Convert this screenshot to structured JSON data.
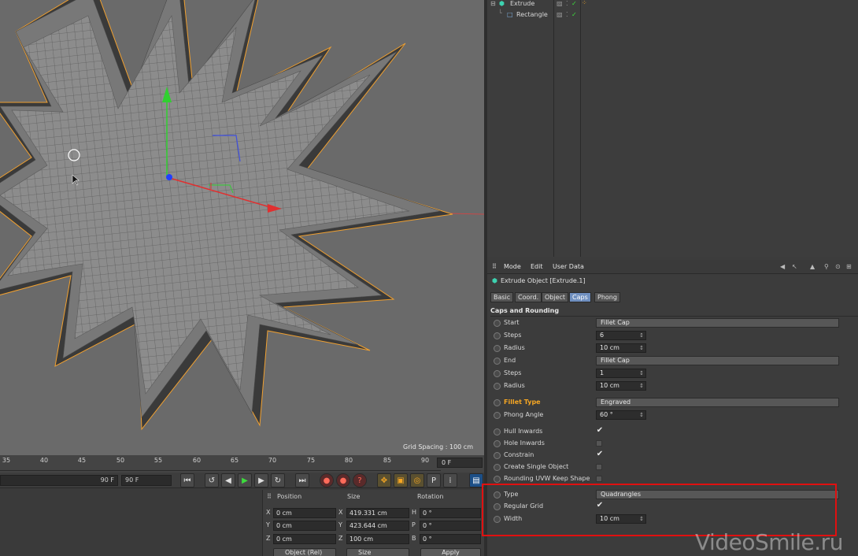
{
  "viewport": {
    "grid_spacing": "Grid Spacing : 100 cm"
  },
  "timeline": {
    "ticks": [
      "35",
      "40",
      "45",
      "50",
      "55",
      "60",
      "65",
      "70",
      "75",
      "80",
      "85",
      "90"
    ],
    "frame_field": "0 F"
  },
  "transport": {
    "end_frame_slider": "90 F",
    "end_frame_field": "90 F"
  },
  "coord_manager": {
    "headers": {
      "position": "Position",
      "size": "Size",
      "rotation": "Rotation"
    },
    "rows": [
      {
        "axis": "X",
        "pos": "0 cm",
        "size_axis": "X",
        "size": "419.331 cm",
        "rot_axis": "H",
        "rot": "0 °"
      },
      {
        "axis": "Y",
        "pos": "0 cm",
        "size_axis": "Y",
        "size": "423.644 cm",
        "rot_axis": "P",
        "rot": "0 °"
      },
      {
        "axis": "Z",
        "pos": "0 cm",
        "size_axis": "Z",
        "size": "100 cm",
        "rot_axis": "B",
        "rot": "0 °"
      }
    ],
    "mode_dropdown": "Object (Rel)",
    "size_dropdown": "Size",
    "apply": "Apply"
  },
  "object_manager": {
    "items": [
      {
        "name": "Extrude"
      },
      {
        "name": "Rectangle"
      }
    ]
  },
  "attributes": {
    "menu": [
      "Mode",
      "Edit",
      "User Data"
    ],
    "title": "Extrude Object [Extrude.1]",
    "tabs": [
      "Basic",
      "Coord.",
      "Object",
      "Caps",
      "Phong"
    ],
    "active_tab": "Caps",
    "section": "Caps and Rounding",
    "params": {
      "start": {
        "label": "Start",
        "value": "Fillet Cap"
      },
      "steps1": {
        "label": "Steps",
        "value": "6"
      },
      "radius1": {
        "label": "Radius",
        "value": "10 cm"
      },
      "end": {
        "label": "End",
        "value": "Fillet Cap"
      },
      "steps2": {
        "label": "Steps",
        "value": "1"
      },
      "radius2": {
        "label": "Radius",
        "value": "10 cm"
      },
      "fillet_type": {
        "label": "Fillet Type",
        "value": "Engraved"
      },
      "phong_angle": {
        "label": "Phong Angle",
        "value": "60 °"
      },
      "hull_inwards": {
        "label": "Hull Inwards",
        "checked": "✔"
      },
      "hole_inwards": {
        "label": "Hole Inwards"
      },
      "constrain": {
        "label": "Constrain",
        "checked": "✔"
      },
      "single_object": {
        "label": "Create Single Object"
      },
      "rounding_uvw": {
        "label": "Rounding UVW Keep Shape"
      },
      "type": {
        "label": "Type",
        "value": "Quadrangles"
      },
      "regular_grid": {
        "label": "Regular Grid",
        "checked": "✔"
      },
      "width": {
        "label": "Width",
        "value": "10 cm"
      }
    }
  },
  "watermark": "VideoSmile.ru",
  "colors": {
    "accent_blue": "#6f8fbf",
    "highlight_red": "#e01010",
    "fillet_label": "#f5a623"
  }
}
